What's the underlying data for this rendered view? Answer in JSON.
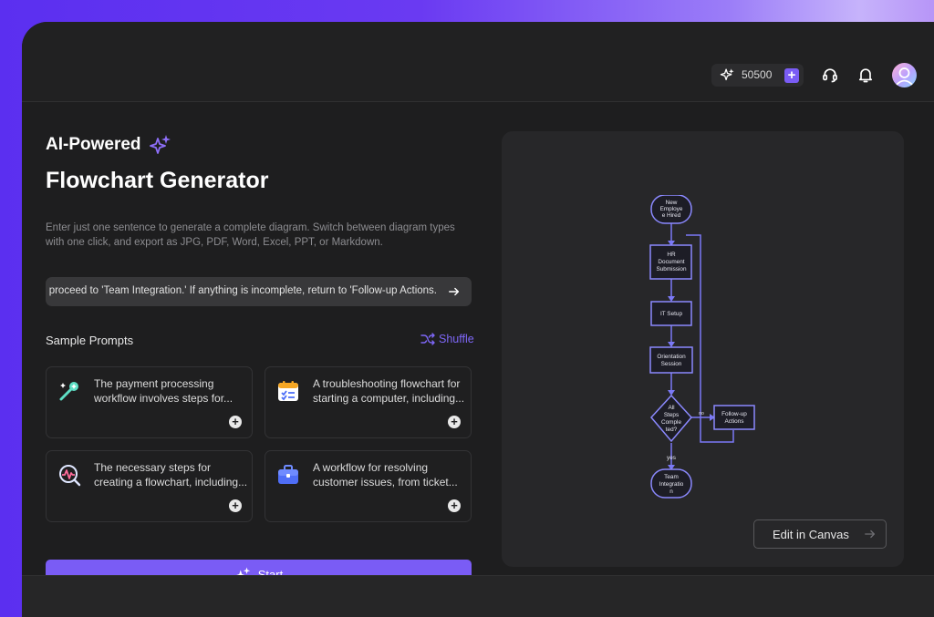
{
  "topbar": {
    "credits": "50500",
    "plus_label": "+",
    "icons": [
      "sparkle-icon",
      "headset-icon",
      "bell-icon",
      "avatar"
    ]
  },
  "hero": {
    "eyebrow": "AI-Powered",
    "title": "Flowchart Generator",
    "description": "Enter just one sentence to generate a complete diagram. Switch between diagram types with one click, and export as JPG, PDF, Word, Excel, PPT, or Markdown."
  },
  "prompt_input": {
    "value": "d, proceed to 'Team Integration.' If anything is incomplete, return to 'Follow-up Actions."
  },
  "samples": {
    "title": "Sample Prompts",
    "shuffle_label": "Shuffle",
    "cards": [
      {
        "text": "The payment processing workflow involves steps for...",
        "icon": "magic-wand-icon"
      },
      {
        "text": "A troubleshooting flowchart for starting a computer, including...",
        "icon": "checklist-icon"
      },
      {
        "text": "The necessary steps for creating a flowchart, including...",
        "icon": "activity-search-icon"
      },
      {
        "text": "A workflow for resolving customer issues, from ticket...",
        "icon": "briefcase-icon"
      }
    ]
  },
  "start_label": "Start",
  "preview": {
    "edit_label": "Edit in Canvas",
    "nodes": {
      "n1": [
        "New",
        "Employe",
        "e Hired"
      ],
      "n2": [
        "HR",
        "Document",
        "Submission"
      ],
      "n3": [
        "IT Setup"
      ],
      "n4": [
        "Orientation",
        "Session"
      ],
      "n5": [
        "All",
        "Steps",
        "Comple",
        "ted?"
      ],
      "n6": [
        "Follow-up",
        "Actions"
      ],
      "n7": [
        "Team",
        "Integratio",
        "n"
      ]
    },
    "edge_labels": {
      "yes": "yes",
      "no": "no"
    }
  },
  "colors": {
    "accent": "#7a5cf5",
    "flow_stroke": "#7b79f7",
    "background": "#1e1e1f"
  }
}
